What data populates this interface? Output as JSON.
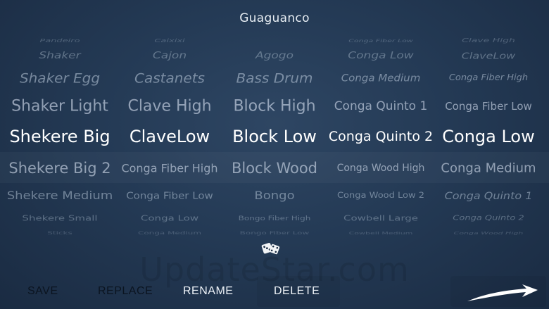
{
  "header": {
    "title": "Guaguanco"
  },
  "picker": {
    "columns": [
      {
        "items": [
          "Pandeiro",
          "Shaker",
          "Shaker Egg",
          "Shaker Light",
          "Shekere Big",
          "Shekere Big 2",
          "Shekere Medium",
          "Shekere Small",
          "Sticks"
        ],
        "selected": "Shekere Big"
      },
      {
        "items": [
          "Caixixi",
          "Cajon",
          "Castanets",
          "Clave High",
          "ClaveLow",
          "Conga Fiber High",
          "Conga Fiber Low",
          "Conga Low",
          "Conga Medium"
        ],
        "selected": "ClaveLow"
      },
      {
        "items": [
          "",
          "Agogo",
          "Bass Drum",
          "Block High",
          "Block Low",
          "Block Wood",
          "Bongo",
          "Bongo Fiber High",
          "Bongo Fiber Low"
        ],
        "selected": "Block Low"
      },
      {
        "items": [
          "Conga Fiber Low",
          "Conga Low",
          "Conga Medium",
          "Conga Quinto 1",
          "Conga Quinto 2",
          "Conga Wood High",
          "Conga Wood Low 2",
          "Cowbell Large",
          "Cowbell Medium"
        ],
        "selected": "Conga Quinto 2"
      },
      {
        "items": [
          "Clave High",
          "ClaveLow",
          "Conga Fiber High",
          "Conga Fiber Low",
          "Conga Low",
          "Conga Medium",
          "Conga Quinto 1",
          "Conga Quinto 2",
          "Conga Wood High"
        ],
        "selected": "Conga Low"
      }
    ]
  },
  "watermark": "UpdateStar.com",
  "icons": {
    "dice": "dice-icon",
    "forward": "forward-arrow-icon"
  },
  "toolbar": {
    "save_label": "SAVE",
    "replace_label": "REPLACE",
    "rename_label": "RENAME",
    "delete_label": "DELETE"
  }
}
